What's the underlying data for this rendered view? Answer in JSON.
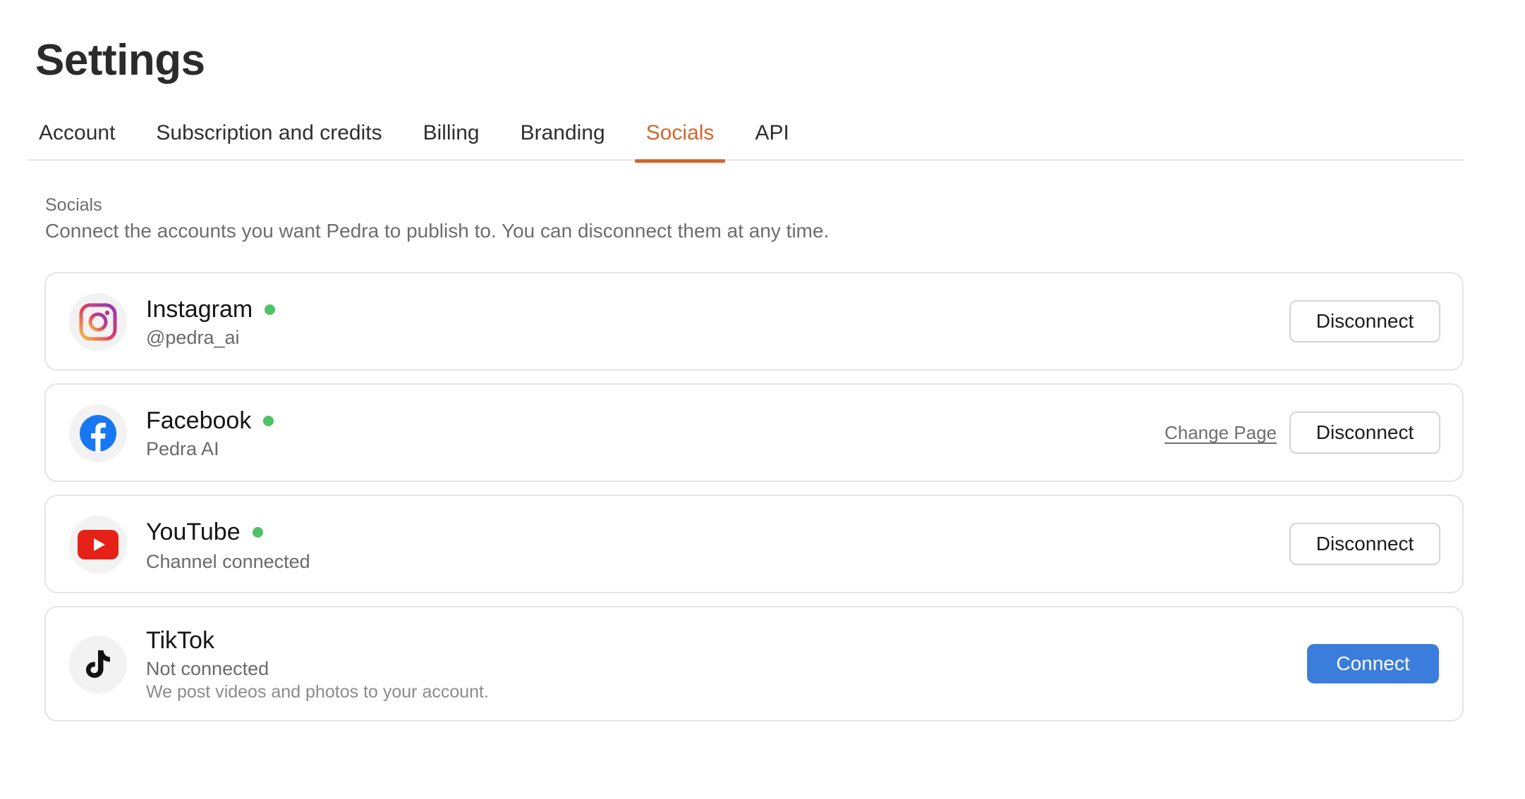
{
  "page": {
    "title": "Settings"
  },
  "tabs": [
    {
      "label": "Account",
      "active": false
    },
    {
      "label": "Subscription and credits",
      "active": false
    },
    {
      "label": "Billing",
      "active": false
    },
    {
      "label": "Branding",
      "active": false
    },
    {
      "label": "Socials",
      "active": true
    },
    {
      "label": "API",
      "active": false
    }
  ],
  "section": {
    "label": "Socials",
    "description": "Connect the accounts you want Pedra to publish to. You can disconnect them at any time."
  },
  "accounts": [
    {
      "name": "Instagram",
      "icon": "instagram-icon",
      "connected": true,
      "subtitle": "@pedra_ai",
      "action_label": "Disconnect"
    },
    {
      "name": "Facebook",
      "icon": "facebook-icon",
      "connected": true,
      "subtitle": "Pedra AI",
      "secondary_action_label": "Change Page",
      "action_label": "Disconnect"
    },
    {
      "name": "YouTube",
      "icon": "youtube-icon",
      "connected": true,
      "subtitle": "Channel connected",
      "action_label": "Disconnect"
    },
    {
      "name": "TikTok",
      "icon": "tiktok-icon",
      "connected": false,
      "subtitle": "Not connected",
      "note": "We post videos and photos to your account.",
      "action_label": "Connect"
    }
  ],
  "colors": {
    "accent_tab": "#d2672c",
    "status_connected": "#4cc364",
    "primary_button": "#3b7ddd",
    "youtube_red": "#e62117",
    "facebook_blue": "#1877f2"
  }
}
